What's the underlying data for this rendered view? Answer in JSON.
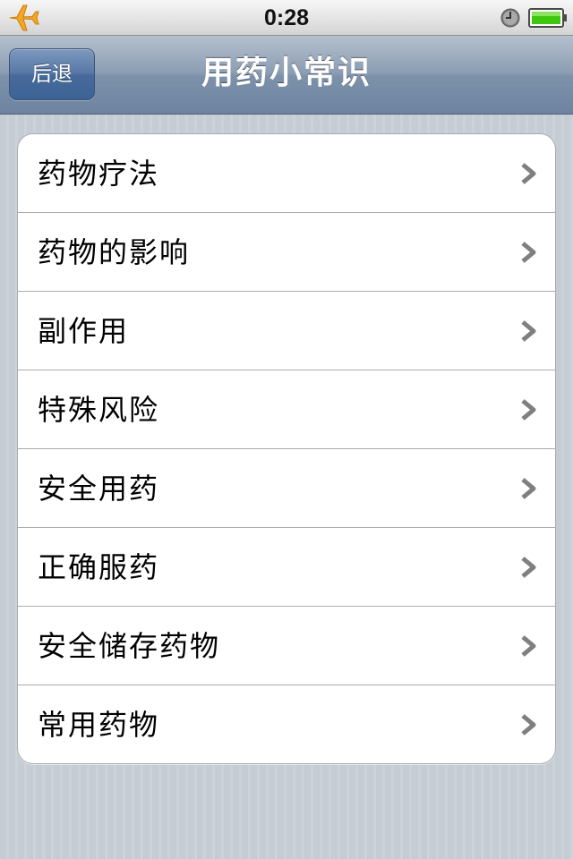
{
  "status_bar": {
    "time": "0:28",
    "icons": [
      "airplane-icon",
      "clock-icon",
      "battery-icon"
    ],
    "airplane_color": "#f5a623",
    "battery_color": "#3fc70f"
  },
  "nav_bar": {
    "title": "用药小常识",
    "back_label": "后退"
  },
  "menu": {
    "items": [
      {
        "label": "药物疗法"
      },
      {
        "label": "药物的影响"
      },
      {
        "label": "副作用"
      },
      {
        "label": "特殊风险"
      },
      {
        "label": "安全用药"
      },
      {
        "label": "正确服药"
      },
      {
        "label": "安全储存药物"
      },
      {
        "label": "常用药物"
      }
    ],
    "chevron_icon": "chevron-right-icon"
  }
}
